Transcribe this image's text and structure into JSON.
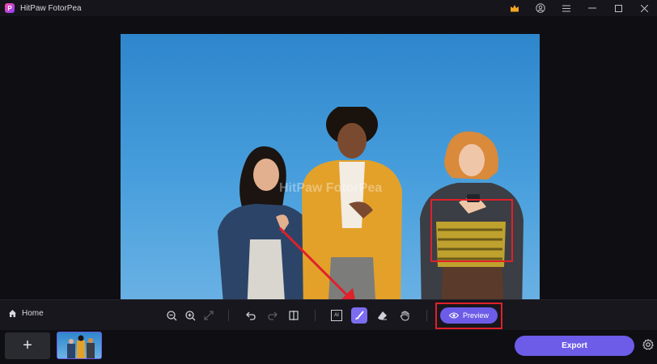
{
  "app": {
    "title": "HitPaw FotorPea",
    "logo_letter": "P"
  },
  "toolbar": {
    "home_label": "Home",
    "preview_label": "Preview",
    "ai_label": "AI"
  },
  "bottom": {
    "add_symbol": "+",
    "export_label": "Export"
  },
  "watermark": "HitPaw FotorPea",
  "colors": {
    "accent": "#6c5ce7",
    "highlight": "#e0202a",
    "background": "#0f0f13",
    "sky": "#4aa0dd"
  },
  "icons": {
    "titlebar": [
      "crown-icon",
      "account-icon",
      "menu-icon",
      "minimize-icon",
      "maximize-icon",
      "close-icon"
    ],
    "tools": [
      "zoom-out-icon",
      "zoom-in-icon",
      "fit-screen-icon",
      "undo-icon",
      "redo-icon",
      "compare-icon",
      "ai-select-icon",
      "brush-icon",
      "eraser-icon",
      "hand-icon",
      "eye-icon"
    ]
  }
}
